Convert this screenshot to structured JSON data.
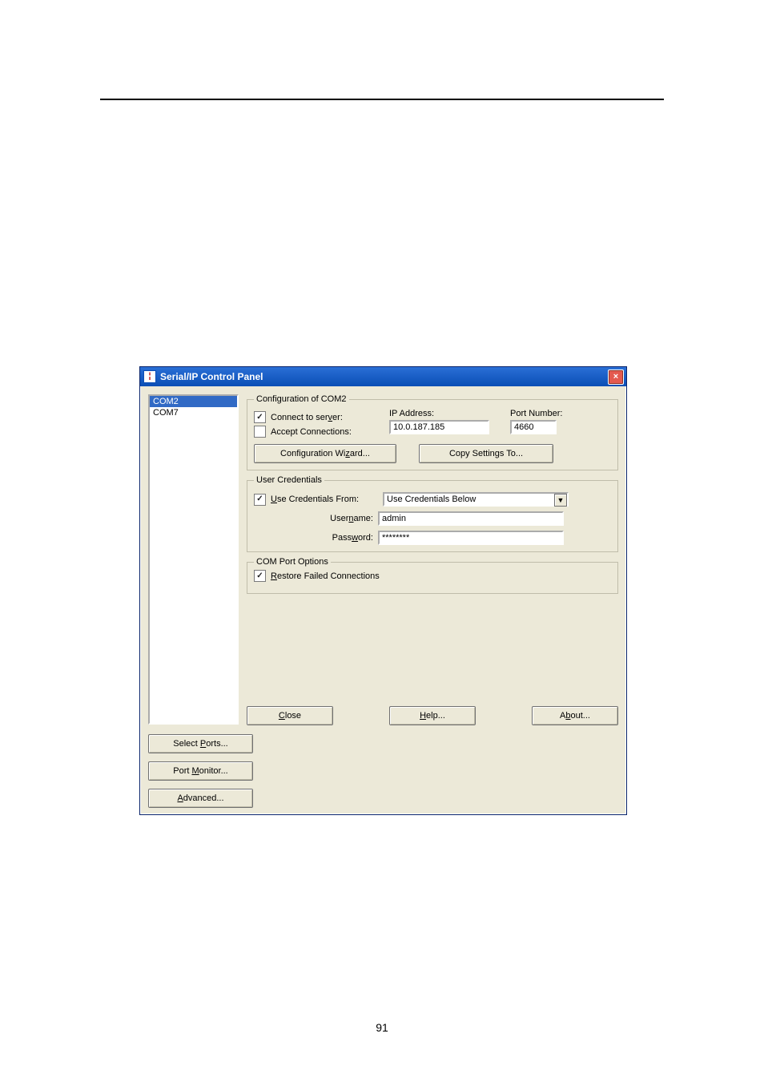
{
  "page_number": "91",
  "window": {
    "title": "Serial/IP Control Panel"
  },
  "port_list": [
    "COM2",
    "COM7"
  ],
  "selected_port_index": 0,
  "side_buttons": {
    "select_ports": "Select Ports...",
    "port_monitor": "Port Monitor...",
    "advanced": "Advanced..."
  },
  "config": {
    "legend": "Configuration of COM2",
    "connect": {
      "label": "Connect to server:",
      "checked": true
    },
    "accept": {
      "label": "Accept Connections:",
      "checked": false
    },
    "ip_label": "IP Address:",
    "ip_value": "10.0.187.185",
    "port_label": "Port Number:",
    "port_value": "4660",
    "wizard_btn": "Configuration Wizard...",
    "copy_btn": "Copy Settings To..."
  },
  "creds": {
    "legend": "User Credentials",
    "use": {
      "label": "Use Credentials From:",
      "checked": true
    },
    "from_value": "Use Credentials Below",
    "username_label": "Username:",
    "username_value": "admin",
    "password_label": "Password:",
    "password_value": "********"
  },
  "com_opts": {
    "legend": "COM Port Options",
    "restore": {
      "label": "Restore Failed Connections",
      "checked": true
    }
  },
  "bottom": {
    "close": "Close",
    "help": "Help...",
    "about": "About..."
  }
}
